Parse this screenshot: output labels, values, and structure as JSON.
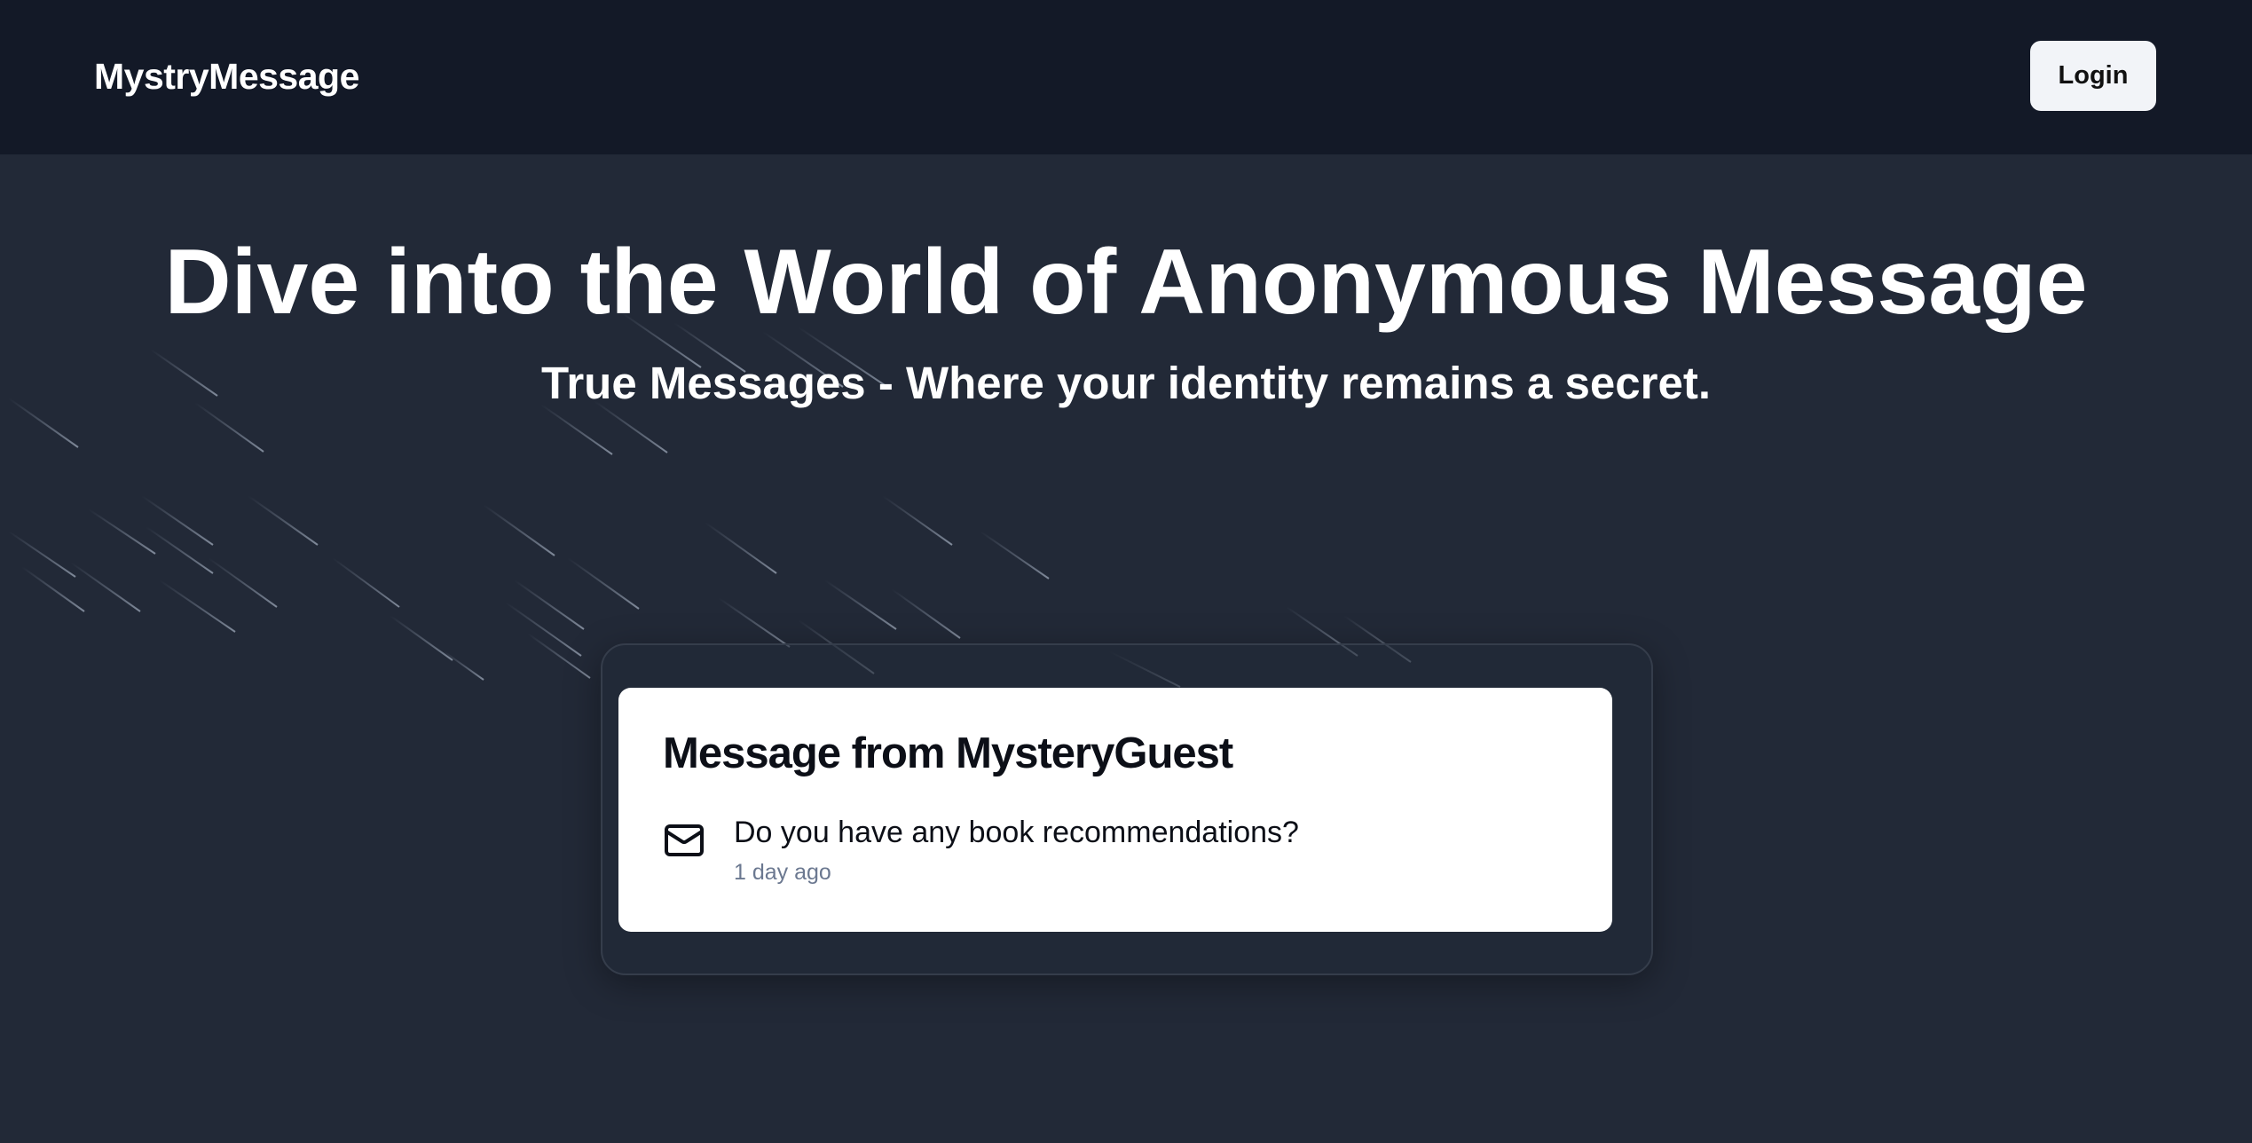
{
  "navbar": {
    "brand": "MystryMessage",
    "login_label": "Login"
  },
  "hero": {
    "title": "Dive into the World of Anonymous Message",
    "subtitle": "True Messages - Where your identity remains a secret."
  },
  "carousel": {
    "items": [
      {
        "title": "Message from MysteryGuest",
        "content": "Do you have any book recommendations?",
        "received": "1 day ago"
      }
    ]
  },
  "icons": {
    "message": "mail-icon"
  },
  "colors": {
    "navbar_bg": "#131927",
    "page_bg": "#222937",
    "card_bg": "#ffffff",
    "timestamp": "#6b7890"
  }
}
